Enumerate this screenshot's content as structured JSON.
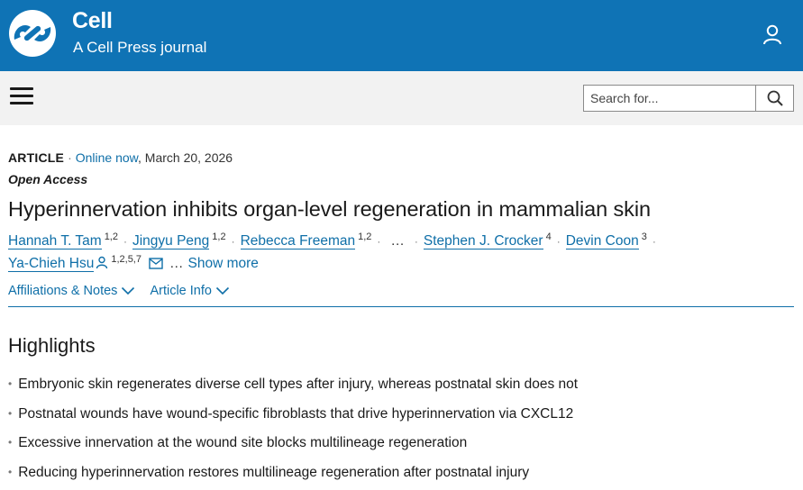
{
  "header": {
    "brand_name": "Cell",
    "brand_subtitle": "A Cell Press journal",
    "bg_color": "#0f73b5"
  },
  "nav": {
    "menu_icon": "hamburger-menu-icon",
    "search_placeholder": "Search for...",
    "search_icon": "search-icon"
  },
  "article": {
    "type": "ARTICLE",
    "online_label": "Online now",
    "date": "March 20, 2026",
    "access": "Open Access",
    "title": "Hyperinnervation inhibits organ-level regeneration in mammalian skin",
    "authors_line1": [
      {
        "name": "Hannah T. Tam",
        "affil": "1,2"
      },
      {
        "name": "Jingyu Peng",
        "affil": "1,2"
      },
      {
        "name": "Rebecca Freeman",
        "affil": "1,2"
      },
      {
        "name": "Stephen J. Crocker",
        "affil": "4"
      },
      {
        "name": "Devin Coon",
        "affil": "3"
      }
    ],
    "ellipsis": "…",
    "corresponding_author": {
      "name": "Ya-Chieh Hsu",
      "affil": "1,2,5,7"
    },
    "show_more": "Show more",
    "link_color": "#0f6fa8"
  },
  "expanders": {
    "affiliations": "Affiliations & Notes",
    "article_info": "Article Info"
  },
  "highlights": {
    "heading": "Highlights",
    "items": [
      "Embryonic skin regenerates diverse cell types after injury, whereas postnatal skin does not",
      "Postnatal wounds have wound-specific fibroblasts that drive hyperinnervation via CXCL12",
      "Excessive innervation at the wound site blocks multilineage regeneration",
      "Reducing hyperinnervation restores multilineage regeneration after postnatal injury"
    ]
  }
}
